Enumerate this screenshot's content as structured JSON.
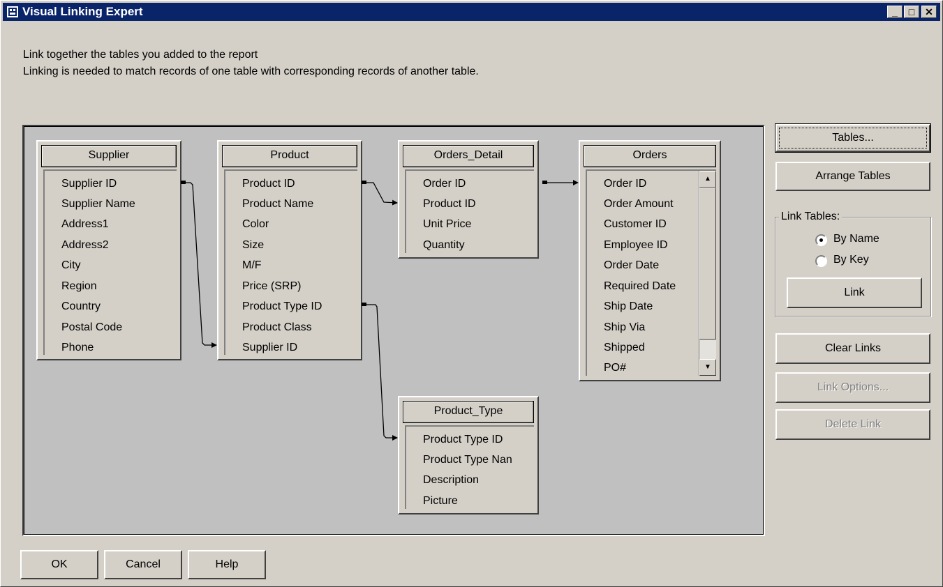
{
  "window": {
    "title": "Visual Linking Expert"
  },
  "title_buttons": {
    "minimize": "_",
    "maximize": "□",
    "close": "✕"
  },
  "intro": {
    "line1": "Link together the tables you added to the report",
    "line2": "Linking is needed to match records of one table with corresponding records of another table."
  },
  "tables": {
    "supplier": {
      "name": "Supplier",
      "fields": [
        "Supplier ID",
        "Supplier Name",
        "Address1",
        "Address2",
        "City",
        "Region",
        "Country",
        "Postal Code",
        "Phone"
      ]
    },
    "product": {
      "name": "Product",
      "fields": [
        "Product ID",
        "Product Name",
        "Color",
        "Size",
        "M/F",
        "Price (SRP)",
        "Product Type ID",
        "Product Class",
        "Supplier ID"
      ]
    },
    "orders_detail": {
      "name": "Orders_Detail",
      "fields": [
        "Order ID",
        "Product ID",
        "Unit Price",
        "Quantity"
      ]
    },
    "orders": {
      "name": "Orders",
      "fields": [
        "Order ID",
        "Order Amount",
        "Customer ID",
        "Employee ID",
        "Order Date",
        "Required Date",
        "Ship Date",
        "Ship Via",
        "Shipped",
        "PO#"
      ]
    },
    "product_type": {
      "name": "Product_Type",
      "fields": [
        "Product Type ID",
        "Product Type Nan",
        "Description",
        "Picture"
      ]
    }
  },
  "side": {
    "tables_label": "Tables...",
    "arrange_label": "Arrange Tables",
    "link_tables_label": "Link Tables:",
    "by_name_label": "By Name",
    "by_key_label": "By Key",
    "link_label": "Link",
    "clear_links_label": "Clear Links",
    "link_options_label": "Link Options...",
    "delete_link_label": "Delete Link"
  },
  "footer": {
    "ok_label": "OK",
    "cancel_label": "Cancel",
    "help_label": "Help"
  },
  "colors": {
    "titlebar": "#0a246a",
    "canvas": "#c0c0c0",
    "face": "#d4d0c8"
  }
}
